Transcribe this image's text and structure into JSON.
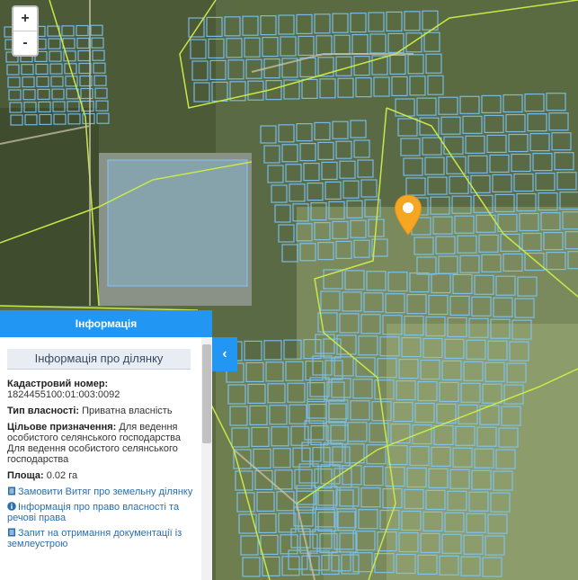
{
  "map": {
    "zoom_in_label": "+",
    "zoom_out_label": "-",
    "marker_icon": "map-pin-icon",
    "marker_color": "#f5a623",
    "parcel_color": "#7ec8ff",
    "boundary_color": "#c8e84a"
  },
  "panel": {
    "header_title": "Інформація",
    "section_title": "Інформація про ділянку",
    "cadastral_label": "Кадастровий номер:",
    "cadastral_value": "1824455100:01:003:0092",
    "ownership_label": "Тип власності:",
    "ownership_value": "Приватна власність",
    "purpose_label": "Цільове призначення:",
    "purpose_value": "Для ведення особистого селянського господарства",
    "purpose_value_2": "Для ведення особистого селянського господарства",
    "area_label": "Площа:",
    "area_value": "0.02 га",
    "links": [
      {
        "icon": "document-icon",
        "label": "Замовити Витяг про земельну ділянку"
      },
      {
        "icon": "info-circle-icon",
        "label": "Інформація про право власності та речові права"
      },
      {
        "icon": "document-icon",
        "label": "Запит на отримання документації із землеустрою"
      }
    ],
    "collapse_icon": "chevron-left-icon",
    "collapse_label": "‹"
  },
  "colors": {
    "accent": "#2196f3",
    "link": "#2a6fb0"
  }
}
